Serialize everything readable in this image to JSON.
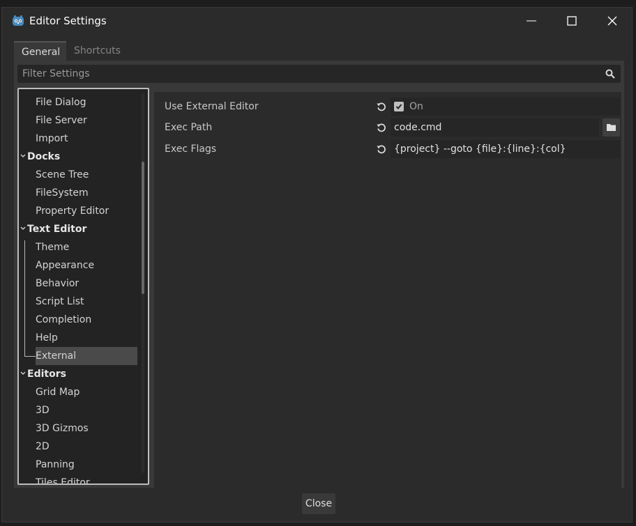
{
  "window": {
    "title": "Editor Settings"
  },
  "tabs": [
    {
      "label": "General"
    },
    {
      "label": "Shortcuts"
    }
  ],
  "filter": {
    "placeholder": "Filter Settings"
  },
  "tree": {
    "items": [
      {
        "label": "File Dialog",
        "type": "leaf"
      },
      {
        "label": "File Server",
        "type": "leaf"
      },
      {
        "label": "Import",
        "type": "leaf"
      },
      {
        "label": "Docks",
        "type": "category"
      },
      {
        "label": "Scene Tree",
        "type": "leaf"
      },
      {
        "label": "FileSystem",
        "type": "leaf"
      },
      {
        "label": "Property Editor",
        "type": "leaf"
      },
      {
        "label": "Text Editor",
        "type": "category"
      },
      {
        "label": "Theme",
        "type": "leaf"
      },
      {
        "label": "Appearance",
        "type": "leaf"
      },
      {
        "label": "Behavior",
        "type": "leaf"
      },
      {
        "label": "Script List",
        "type": "leaf"
      },
      {
        "label": "Completion",
        "type": "leaf"
      },
      {
        "label": "Help",
        "type": "leaf"
      },
      {
        "label": "External",
        "type": "leaf",
        "selected": true
      },
      {
        "label": "Editors",
        "type": "category"
      },
      {
        "label": "Grid Map",
        "type": "leaf"
      },
      {
        "label": "3D",
        "type": "leaf"
      },
      {
        "label": "3D Gizmos",
        "type": "leaf"
      },
      {
        "label": "2D",
        "type": "leaf"
      },
      {
        "label": "Panning",
        "type": "leaf"
      },
      {
        "label": "Tiles Editor",
        "type": "leaf"
      }
    ]
  },
  "properties": [
    {
      "label": "Use External Editor",
      "kind": "checkbox",
      "checked": true,
      "value": "On"
    },
    {
      "label": "Exec Path",
      "kind": "path",
      "value": "code.cmd"
    },
    {
      "label": "Exec Flags",
      "kind": "text",
      "value": "{project} --goto {file}:{line}:{col}"
    }
  ],
  "footer": {
    "close_label": "Close"
  },
  "icons": {
    "app": "godot-logo-icon",
    "minimize": "minimize-icon",
    "maximize": "maximize-icon",
    "close": "close-icon",
    "search": "search-icon",
    "revert": "revert-icon",
    "folder": "folder-icon",
    "chevron": "chevron-down-icon"
  },
  "colors": {
    "accent_logo": "#478cbf",
    "panel": "#393939",
    "field": "#262626"
  }
}
